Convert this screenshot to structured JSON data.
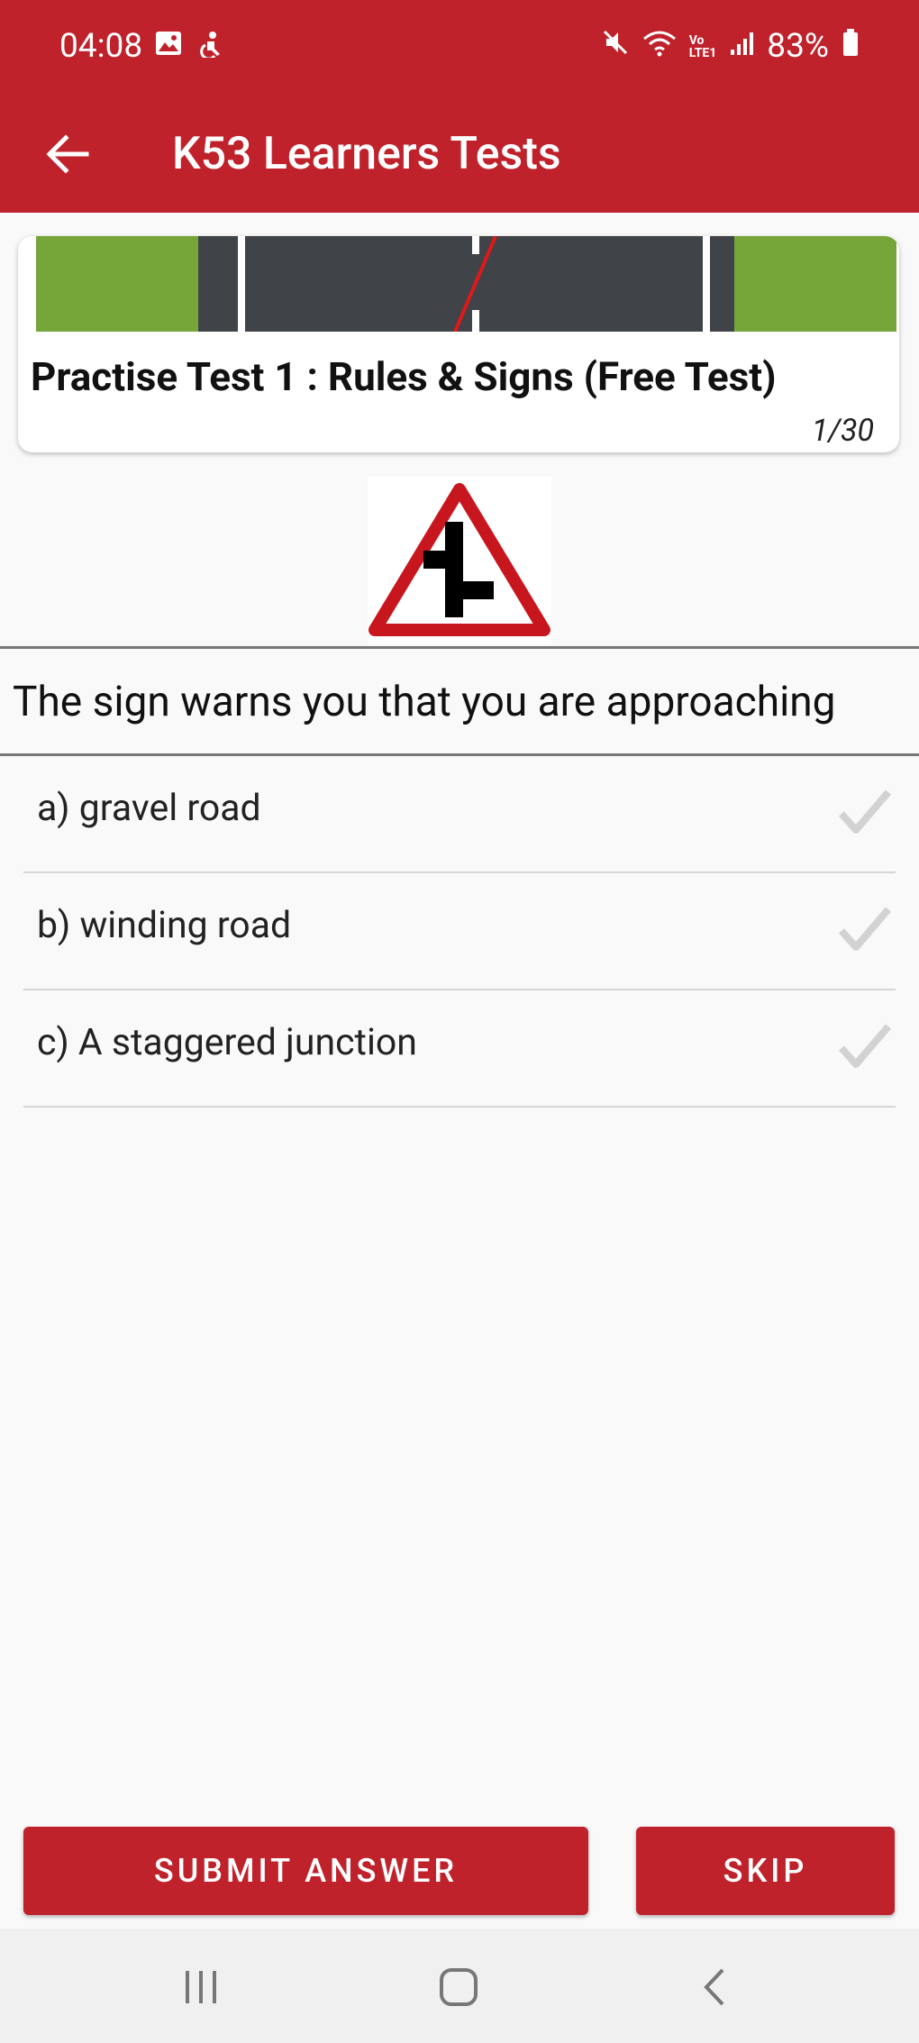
{
  "status_bar": {
    "time": "04:08",
    "battery": "83%",
    "left_icons": [
      "gallery-icon",
      "accessibility-icon"
    ],
    "right_icons": [
      "mute-icon",
      "wifi-icon",
      "volte-icon",
      "signal-icon",
      "battery-icon"
    ]
  },
  "app_bar": {
    "title": "K53 Learners Tests",
    "back_icon": "arrow-left-icon"
  },
  "test_card": {
    "title": "Practise Test 1 : Rules & Signs (Free Test)",
    "progress": "1/30"
  },
  "question": {
    "sign_icon": "staggered-junction-sign",
    "text": "The sign warns you that you are approaching",
    "options": [
      {
        "label": "a) gravel road",
        "checked": false
      },
      {
        "label": "b) winding road",
        "checked": false
      },
      {
        "label": "c) A staggered junction",
        "checked": false
      }
    ]
  },
  "actions": {
    "submit_label": "SUBMIT ANSWER",
    "skip_label": "SKIP"
  },
  "nav_bar": {
    "icons": [
      "recents-icon",
      "home-icon",
      "back-icon"
    ]
  },
  "colors": {
    "brand_red": "#c0222c",
    "background": "#f9f9f9",
    "road_grey": "#404347",
    "grass_green": "#76a63a"
  }
}
